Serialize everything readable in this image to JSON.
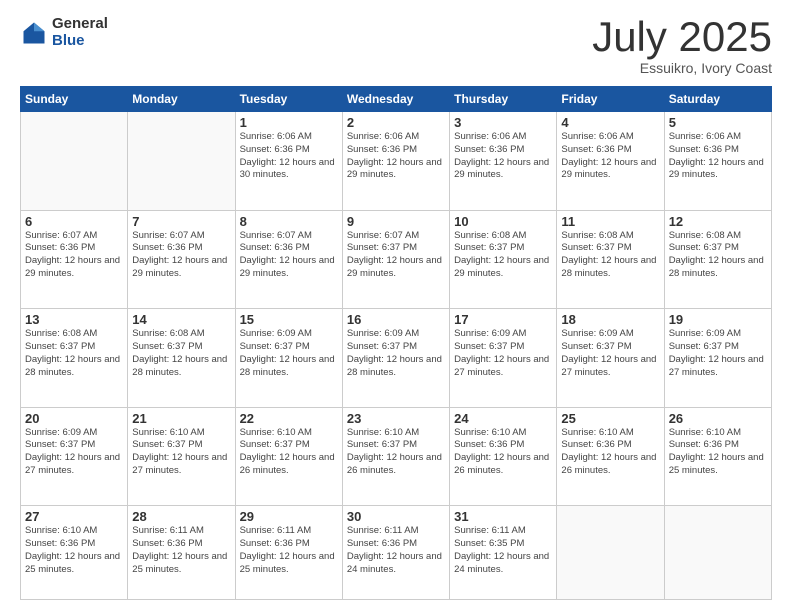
{
  "logo": {
    "general": "General",
    "blue": "Blue"
  },
  "header": {
    "month": "July 2025",
    "location": "Essuikro, Ivory Coast"
  },
  "days_of_week": [
    "Sunday",
    "Monday",
    "Tuesday",
    "Wednesday",
    "Thursday",
    "Friday",
    "Saturday"
  ],
  "weeks": [
    [
      {
        "day": "",
        "info": ""
      },
      {
        "day": "",
        "info": ""
      },
      {
        "day": "1",
        "info": "Sunrise: 6:06 AM\nSunset: 6:36 PM\nDaylight: 12 hours and 30 minutes."
      },
      {
        "day": "2",
        "info": "Sunrise: 6:06 AM\nSunset: 6:36 PM\nDaylight: 12 hours and 29 minutes."
      },
      {
        "day": "3",
        "info": "Sunrise: 6:06 AM\nSunset: 6:36 PM\nDaylight: 12 hours and 29 minutes."
      },
      {
        "day": "4",
        "info": "Sunrise: 6:06 AM\nSunset: 6:36 PM\nDaylight: 12 hours and 29 minutes."
      },
      {
        "day": "5",
        "info": "Sunrise: 6:06 AM\nSunset: 6:36 PM\nDaylight: 12 hours and 29 minutes."
      }
    ],
    [
      {
        "day": "6",
        "info": "Sunrise: 6:07 AM\nSunset: 6:36 PM\nDaylight: 12 hours and 29 minutes."
      },
      {
        "day": "7",
        "info": "Sunrise: 6:07 AM\nSunset: 6:36 PM\nDaylight: 12 hours and 29 minutes."
      },
      {
        "day": "8",
        "info": "Sunrise: 6:07 AM\nSunset: 6:36 PM\nDaylight: 12 hours and 29 minutes."
      },
      {
        "day": "9",
        "info": "Sunrise: 6:07 AM\nSunset: 6:37 PM\nDaylight: 12 hours and 29 minutes."
      },
      {
        "day": "10",
        "info": "Sunrise: 6:08 AM\nSunset: 6:37 PM\nDaylight: 12 hours and 29 minutes."
      },
      {
        "day": "11",
        "info": "Sunrise: 6:08 AM\nSunset: 6:37 PM\nDaylight: 12 hours and 28 minutes."
      },
      {
        "day": "12",
        "info": "Sunrise: 6:08 AM\nSunset: 6:37 PM\nDaylight: 12 hours and 28 minutes."
      }
    ],
    [
      {
        "day": "13",
        "info": "Sunrise: 6:08 AM\nSunset: 6:37 PM\nDaylight: 12 hours and 28 minutes."
      },
      {
        "day": "14",
        "info": "Sunrise: 6:08 AM\nSunset: 6:37 PM\nDaylight: 12 hours and 28 minutes."
      },
      {
        "day": "15",
        "info": "Sunrise: 6:09 AM\nSunset: 6:37 PM\nDaylight: 12 hours and 28 minutes."
      },
      {
        "day": "16",
        "info": "Sunrise: 6:09 AM\nSunset: 6:37 PM\nDaylight: 12 hours and 28 minutes."
      },
      {
        "day": "17",
        "info": "Sunrise: 6:09 AM\nSunset: 6:37 PM\nDaylight: 12 hours and 27 minutes."
      },
      {
        "day": "18",
        "info": "Sunrise: 6:09 AM\nSunset: 6:37 PM\nDaylight: 12 hours and 27 minutes."
      },
      {
        "day": "19",
        "info": "Sunrise: 6:09 AM\nSunset: 6:37 PM\nDaylight: 12 hours and 27 minutes."
      }
    ],
    [
      {
        "day": "20",
        "info": "Sunrise: 6:09 AM\nSunset: 6:37 PM\nDaylight: 12 hours and 27 minutes."
      },
      {
        "day": "21",
        "info": "Sunrise: 6:10 AM\nSunset: 6:37 PM\nDaylight: 12 hours and 27 minutes."
      },
      {
        "day": "22",
        "info": "Sunrise: 6:10 AM\nSunset: 6:37 PM\nDaylight: 12 hours and 26 minutes."
      },
      {
        "day": "23",
        "info": "Sunrise: 6:10 AM\nSunset: 6:37 PM\nDaylight: 12 hours and 26 minutes."
      },
      {
        "day": "24",
        "info": "Sunrise: 6:10 AM\nSunset: 6:36 PM\nDaylight: 12 hours and 26 minutes."
      },
      {
        "day": "25",
        "info": "Sunrise: 6:10 AM\nSunset: 6:36 PM\nDaylight: 12 hours and 26 minutes."
      },
      {
        "day": "26",
        "info": "Sunrise: 6:10 AM\nSunset: 6:36 PM\nDaylight: 12 hours and 25 minutes."
      }
    ],
    [
      {
        "day": "27",
        "info": "Sunrise: 6:10 AM\nSunset: 6:36 PM\nDaylight: 12 hours and 25 minutes."
      },
      {
        "day": "28",
        "info": "Sunrise: 6:11 AM\nSunset: 6:36 PM\nDaylight: 12 hours and 25 minutes."
      },
      {
        "day": "29",
        "info": "Sunrise: 6:11 AM\nSunset: 6:36 PM\nDaylight: 12 hours and 25 minutes."
      },
      {
        "day": "30",
        "info": "Sunrise: 6:11 AM\nSunset: 6:36 PM\nDaylight: 12 hours and 24 minutes."
      },
      {
        "day": "31",
        "info": "Sunrise: 6:11 AM\nSunset: 6:35 PM\nDaylight: 12 hours and 24 minutes."
      },
      {
        "day": "",
        "info": ""
      },
      {
        "day": "",
        "info": ""
      }
    ]
  ]
}
